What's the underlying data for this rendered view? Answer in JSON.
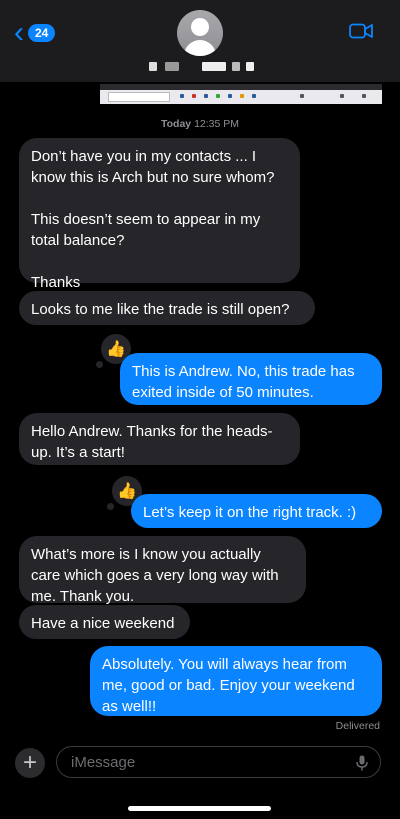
{
  "header": {
    "back_badge": "24",
    "back_icon": "chevron-left-icon",
    "avatar_icon": "person-icon",
    "video_icon": "video-camera-icon"
  },
  "thread": {
    "timestamp_day": "Today",
    "timestamp_time": "12:35 PM"
  },
  "messages": [
    {
      "from": "in",
      "text": "Don’t have you in my contacts ... I know this is Arch but no sure whom?\n\nThis doesn’t seem to appear in my total balance?\n\nThanks"
    },
    {
      "from": "in",
      "text": "Looks to me like the trade is still open?"
    },
    {
      "from": "out",
      "text": "This is Andrew. No, this trade has exited inside of 50 minutes.",
      "tapback": "thumbs-up-icon"
    },
    {
      "from": "in",
      "text": "Hello Andrew. Thanks for the heads-up. It’s a start!"
    },
    {
      "from": "out",
      "text": "Let’s keep it on the right track. :)",
      "tapback": "thumbs-up-icon"
    },
    {
      "from": "in",
      "text": "What’s more is I know you actually care which goes a very long way with me. Thank you."
    },
    {
      "from": "in",
      "text": "Have a nice weekend"
    },
    {
      "from": "out",
      "text": "Absolutely. You will always hear from me, good or bad. Enjoy your weekend as well!!"
    }
  ],
  "status": {
    "delivered": "Delivered"
  },
  "composer": {
    "placeholder": "iMessage",
    "value": "",
    "plus_icon": "plus-icon",
    "mic_icon": "microphone-icon"
  },
  "colors": {
    "accent": "#0a84ff",
    "incoming_bubble": "#26252a",
    "header_bg": "#1c1c1e",
    "muted_text": "#8e8e93"
  }
}
